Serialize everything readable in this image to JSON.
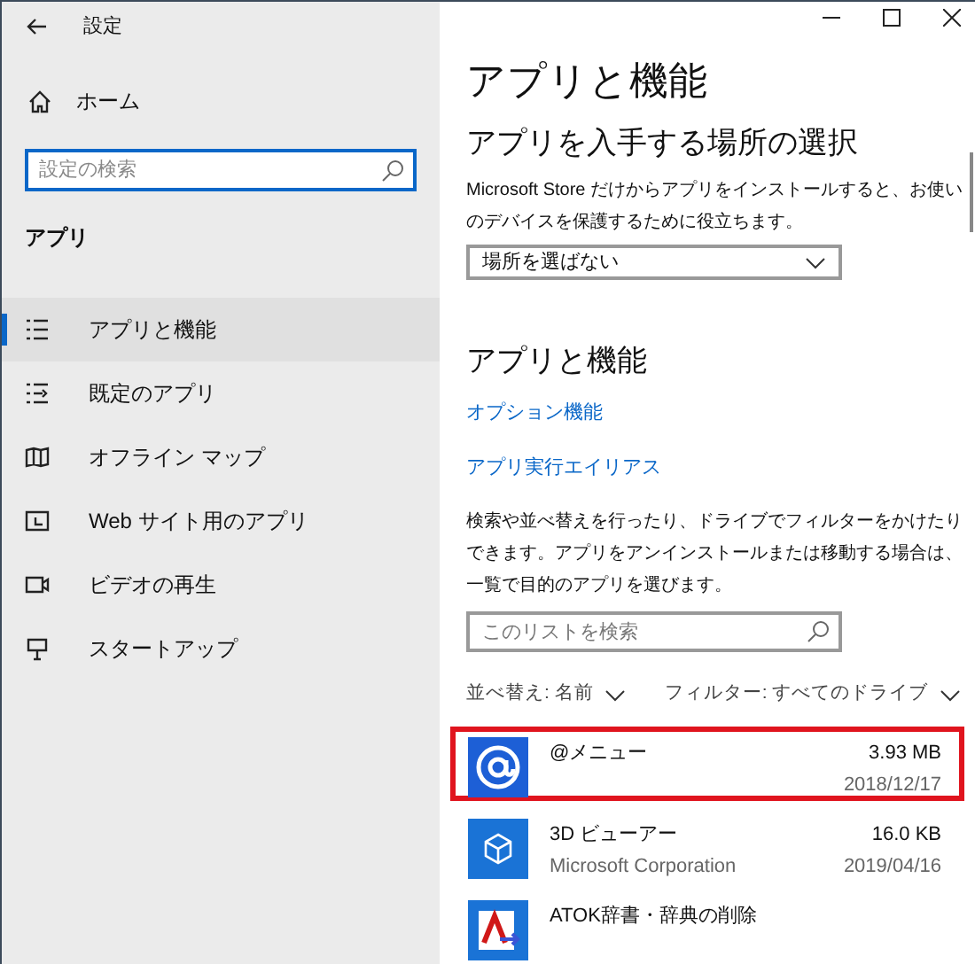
{
  "window": {
    "title": "設定"
  },
  "sidebar": {
    "home": "ホーム",
    "search": {
      "placeholder": "設定の検索"
    },
    "section": "アプリ",
    "items": [
      {
        "label": "アプリと機能",
        "selected": true
      },
      {
        "label": "既定のアプリ",
        "selected": false
      },
      {
        "label": "オフライン マップ",
        "selected": false
      },
      {
        "label": "Web サイト用のアプリ",
        "selected": false
      },
      {
        "label": "ビデオの再生",
        "selected": false
      },
      {
        "label": "スタートアップ",
        "selected": false
      }
    ]
  },
  "main": {
    "title": "アプリと機能",
    "source": {
      "heading": "アプリを入手する場所の選択",
      "description": "Microsoft Store だけからアプリをインストールすると、お使いのデバイスを保護するために役立ちます。",
      "dropdown": "場所を選ばない"
    },
    "apps": {
      "heading": "アプリと機能",
      "links": [
        "オプション機能",
        "アプリ実行エイリアス"
      ],
      "description": "検索や並べ替えを行ったり、ドライブでフィルターをかけたりできます。アプリをアンインストールまたは移動する場合は、一覧で目的のアプリを選びます。",
      "search": {
        "placeholder": "このリストを検索"
      },
      "sort": "並べ替え: 名前",
      "filter": "フィルター: すべてのドライブ",
      "list": [
        {
          "name": "@メニュー",
          "size": "3.93 MB",
          "date": "2018/12/17",
          "highlighted": true
        },
        {
          "name": "3D ビューアー",
          "publisher": "Microsoft Corporation",
          "size": "16.0 KB",
          "date": "2019/04/16",
          "highlighted": false
        },
        {
          "name": "ATOK辞書・辞典の削除",
          "highlighted": false
        }
      ]
    }
  }
}
